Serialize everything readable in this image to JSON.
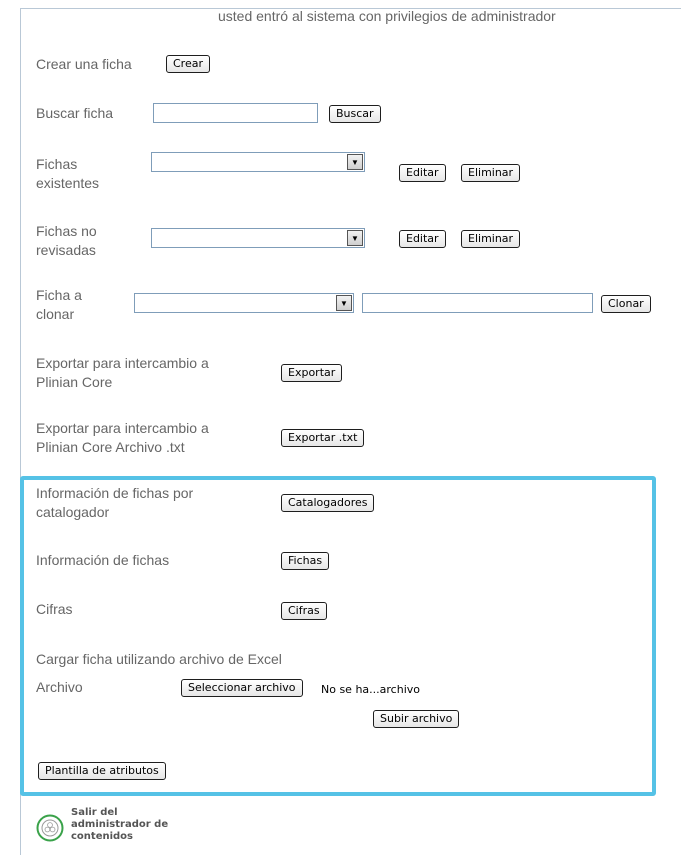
{
  "header": {
    "admin_notice": "usted entró al sistema con privilegios de administrador"
  },
  "crear": {
    "label": "Crear una ficha",
    "button": "Crear"
  },
  "buscar": {
    "label": "Buscar ficha",
    "placeholder": "",
    "button": "Buscar"
  },
  "existentes": {
    "label_1": "Fichas",
    "label_2": "existentes",
    "edit": "Editar",
    "delete": "Eliminar"
  },
  "no_revisadas": {
    "label_1": "Fichas no",
    "label_2": "revisadas",
    "edit": "Editar",
    "delete": "Eliminar"
  },
  "clonar": {
    "label_1": "Ficha a",
    "label_2": "clonar",
    "button": "Clonar"
  },
  "exportar": {
    "label_1": "Exportar para intercambio a",
    "label_2": "Plinian Core",
    "button": "Exportar"
  },
  "exportar_txt": {
    "label_1": "Exportar para intercambio a",
    "label_2": "Plinian Core Archivo .txt",
    "button": "Exportar .txt"
  },
  "catalogadores": {
    "label_1": "Información de fichas por",
    "label_2": "catalogador",
    "button": "Catalogadores"
  },
  "fichas_info": {
    "label": "Información de fichas",
    "button": "Fichas"
  },
  "cifras": {
    "label": "Cifras",
    "button": "Cifras"
  },
  "excel": {
    "heading": "Cargar ficha utilizando archivo de Excel",
    "file_label": "Archivo",
    "select_button": "Seleccionar archivo",
    "file_status": "No se ha...archivo",
    "upload_button": "Subir archivo"
  },
  "plantilla": {
    "button": "Plantilla de atributos"
  },
  "logout": {
    "line_1": "Salir del",
    "line_2": "administrador de",
    "line_3": "contenidos"
  },
  "colors": {
    "highlight": "#55c2e6",
    "text": "#666666"
  }
}
